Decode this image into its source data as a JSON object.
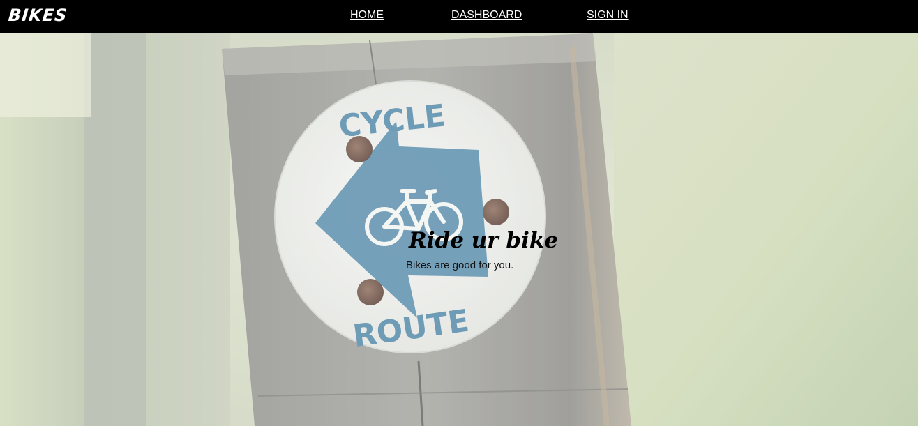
{
  "navbar": {
    "brand": "BIKES",
    "links": [
      {
        "label": "HOME"
      },
      {
        "label": "DASHBOARD"
      },
      {
        "label": "SIGN IN"
      }
    ]
  },
  "hero": {
    "title": "Ride ur bike",
    "subtitle": "Bikes are good for you.",
    "sign_top_text": "CYCLE",
    "sign_bottom_text": "ROUTE"
  },
  "colors": {
    "navbar_bg": "#000000",
    "nav_text": "#ffffff",
    "sign_blue": "#4f86a6",
    "post_gray": "#9a9a94"
  }
}
